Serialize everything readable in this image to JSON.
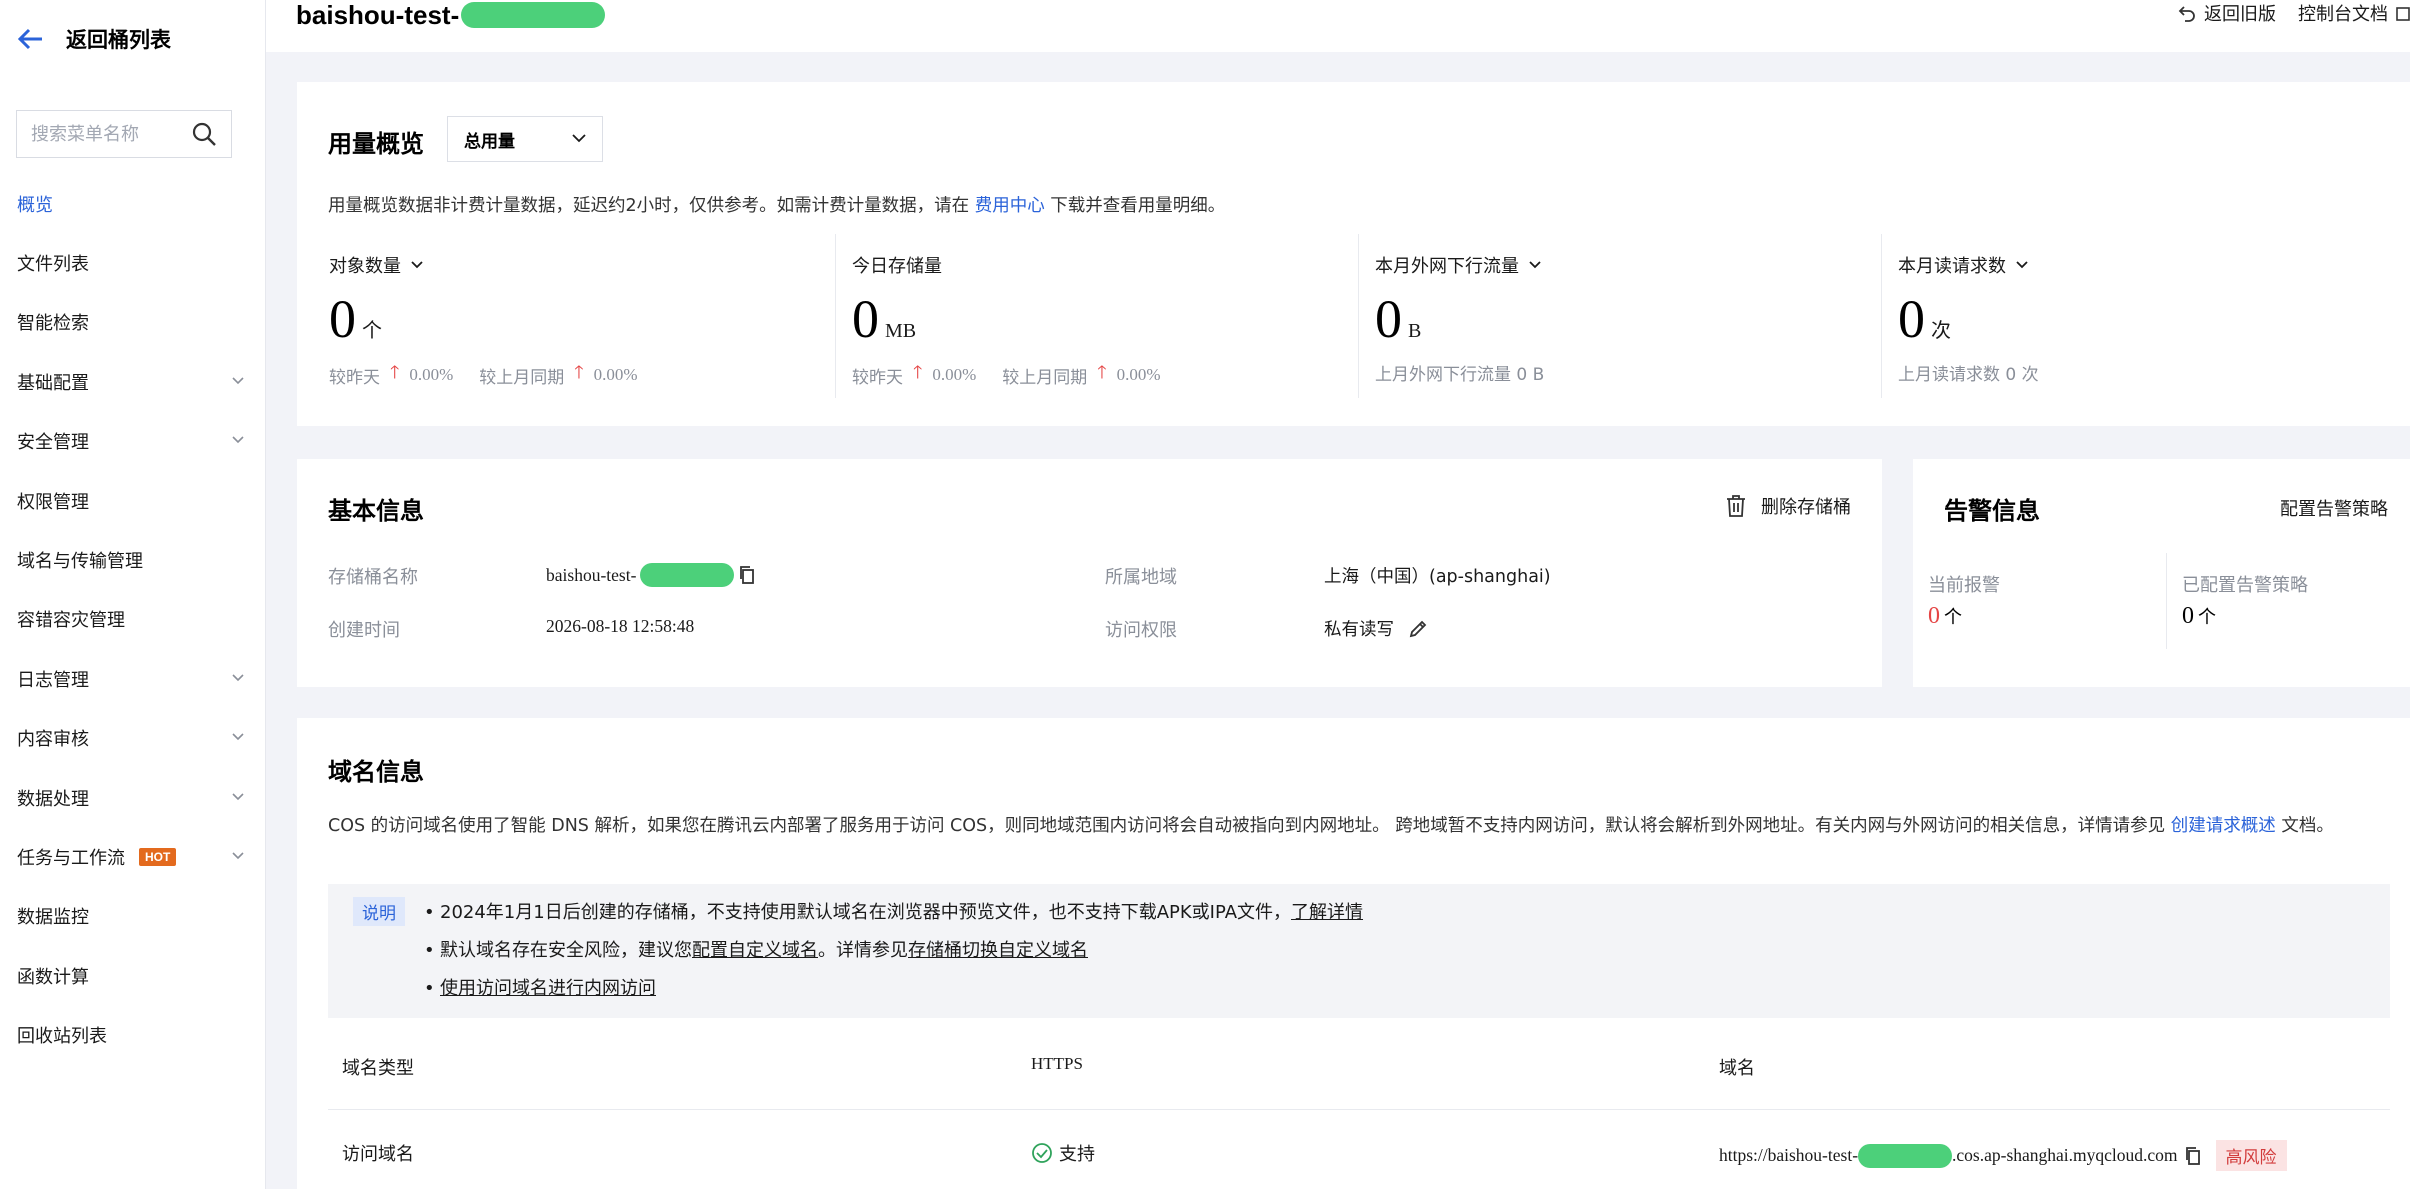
{
  "sidebar": {
    "back_label": "返回桶列表",
    "search_placeholder": "搜索菜单名称",
    "items": [
      {
        "label": "概览"
      },
      {
        "label": "文件列表"
      },
      {
        "label": "智能检索"
      },
      {
        "label": "基础配置"
      },
      {
        "label": "安全管理"
      },
      {
        "label": "权限管理"
      },
      {
        "label": "域名与传输管理"
      },
      {
        "label": "容错容灾管理"
      },
      {
        "label": "日志管理"
      },
      {
        "label": "内容审核"
      },
      {
        "label": "数据处理"
      },
      {
        "label": "任务与工作流",
        "badge": "HOT"
      },
      {
        "label": "数据监控"
      },
      {
        "label": "函数计算"
      },
      {
        "label": "回收站列表"
      }
    ]
  },
  "header": {
    "bucket_title": "baishou-test-",
    "back_old_label": "返回旧版",
    "console_docs_label": "控制台文档"
  },
  "usage": {
    "title": "用量概览",
    "select_value": "总用量",
    "desc_prefix": "用量概览数据非计费计量数据，延迟约2小时，仅供参考。如需计费计量数据，请在",
    "desc_link": "费用中心",
    "desc_suffix": "下载并查看用量明细。",
    "metrics": [
      {
        "label": "对象数量",
        "value": "0",
        "unit": "个",
        "sub1_label": "较昨天",
        "sub1_value": "0.00%",
        "sub2_label": "较上月同期",
        "sub2_value": "0.00%"
      },
      {
        "label": "今日存储量",
        "value": "0",
        "unit": "MB",
        "sub1_label": "较昨天",
        "sub1_value": "0.00%",
        "sub2_label": "较上月同期",
        "sub2_value": "0.00%"
      },
      {
        "label": "本月外网下行流量",
        "value": "0",
        "unit": "B",
        "sub_text": "上月外网下行流量 0 B"
      },
      {
        "label": "本月读请求数",
        "value": "0",
        "unit": "次",
        "sub_text": "上月读请求数 0 次"
      }
    ]
  },
  "basic": {
    "title": "基本信息",
    "delete_label": "删除存储桶",
    "name_label": "存储桶名称",
    "name_value": "baishou-test-",
    "region_label": "所属地域",
    "region_value": "上海（中国）(ap-shanghai)",
    "created_label": "创建时间",
    "created_value": "2026-08-18 12:58:48",
    "access_label": "访问权限",
    "access_value": "私有读写"
  },
  "alarm": {
    "title": "告警信息",
    "config_label": "配置告警策略",
    "current_label": "当前报警",
    "current_value": "0",
    "current_unit": "个",
    "configured_label": "已配置告警策略",
    "configured_value": "0",
    "configured_unit": "个",
    "alert_color": "#e54545"
  },
  "domain": {
    "title": "域名信息",
    "desc_1": "COS 的访问域名使用了智能 DNS 解析，如果您在腾讯云内部署了服务用于访问 COS，则同地域范围内访问将会自动被指向到内网地址。 跨地域暂不支持内网访问，默认将会解析到外网地址。有关内网与外网访问的相关信息，详情请参见",
    "desc_link": "创建请求概述",
    "desc_2": "文档。",
    "notice_tag": "说明",
    "notice_1_text": "2024年1月1日后创建的存储桶，不支持使用默认域名在浏览器中预览文件，也不支持下载APK或IPA文件，",
    "notice_1_link": "了解详情",
    "notice_2_a": "默认域名存在安全风险，建议您",
    "notice_2_link1": "配置自定义域名",
    "notice_2_b": "。详情参见",
    "notice_2_link2": "存储桶切换自定义域名",
    "notice_3_link": "使用访问域名进行内网访问",
    "columns": [
      "域名类型",
      "HTTPS",
      "域名"
    ],
    "row": {
      "type": "访问域名",
      "https": "支持",
      "domain_prefix": "https://baishou-test-",
      "domain_suffix": ".cos.ap-shanghai.myqcloud.com",
      "risk": "高风险"
    }
  },
  "colors": {
    "accent": "#2b63d9",
    "redaction": "#4cd07a",
    "risk_bg": "#fbe3e3",
    "risk_text": "#d23c3c"
  }
}
